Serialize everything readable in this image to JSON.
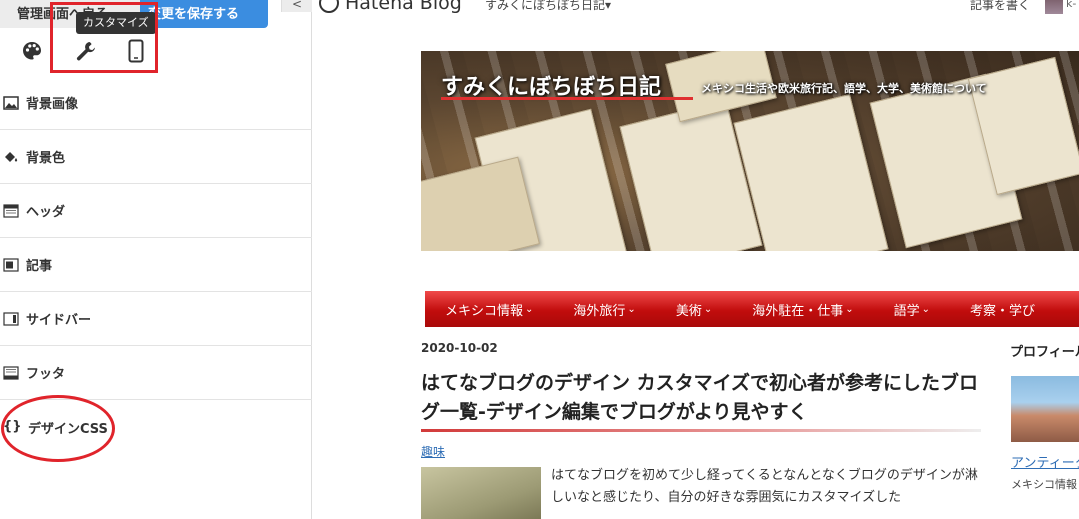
{
  "toolbar": {
    "admin_label": "管理画面へ戻る",
    "save_label": "変更を保存する",
    "collapse_label": "<"
  },
  "mode_icons": {
    "tooltip": "カスタマイズ"
  },
  "menu": {
    "items": [
      {
        "label": "背景画像"
      },
      {
        "label": "背景色"
      },
      {
        "label": "ヘッダ"
      },
      {
        "label": "記事"
      },
      {
        "label": "サイドバー"
      },
      {
        "label": "フッタ"
      },
      {
        "label": "デザインCSS"
      }
    ]
  },
  "hatena_bar": {
    "logo": "Hatena Blog",
    "blog_menu": "すみくにぼちぼち日記▾",
    "write": "記事を書く",
    "user": "k-"
  },
  "blog": {
    "title": "すみくにぼちぼち日記",
    "description": "メキシコ生活や欧米旅行記、語学、大学、美術館について"
  },
  "nav": {
    "items": [
      "メキシコ情報",
      "海外旅行",
      "美術",
      "海外駐在・仕事",
      "語学",
      "考察・学び"
    ],
    "chevron": "❯"
  },
  "post": {
    "date": "2020-10-02",
    "title": "はてなブログのデザイン カスタマイズで初心者が参考にしたブログ一覧-デザイン編集でブログがより見やすく",
    "category": "趣味",
    "excerpt": "はてなブログを初めて少し経ってくるとなんとなくブログのデザインが淋しいなと感じたり、自分の好きな雰囲気にカスタマイズした"
  },
  "sidebar": {
    "title": "プロフィール",
    "link": "アンティーク",
    "text": "メキシコ情報 語学、美術"
  },
  "colors": {
    "save_button": "#3b8de0",
    "highlight": "#e0242b",
    "nav_red": "#c10d0d",
    "link": "#2e6db5"
  }
}
